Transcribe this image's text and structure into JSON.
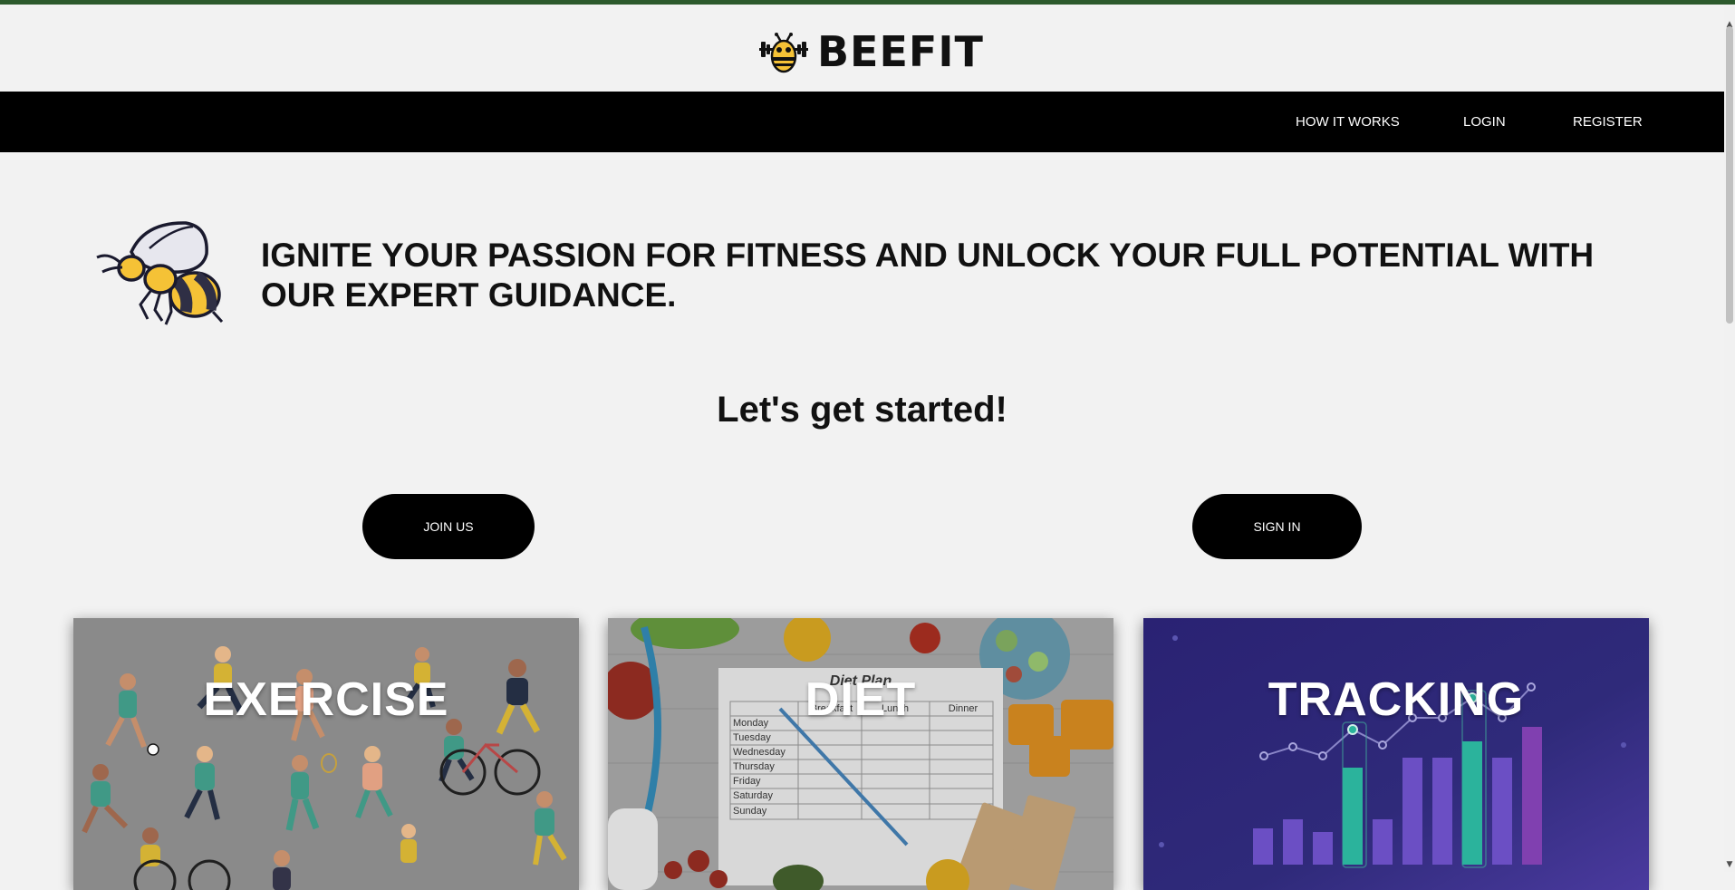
{
  "brand": {
    "name": "BEEFIT",
    "logo_icon": "bee-barbell-icon"
  },
  "nav": {
    "items": [
      {
        "label": "HOW IT WORKS"
      },
      {
        "label": "LOGIN"
      },
      {
        "label": "REGISTER"
      }
    ]
  },
  "hero": {
    "icon": "bee-icon",
    "text": "IGNITE YOUR PASSION FOR FITNESS AND UNLOCK YOUR FULL POTENTIAL WITH OUR EXPERT GUIDANCE."
  },
  "cta": {
    "heading": "Let's get started!",
    "join_label": "JOIN US",
    "signin_label": "SIGN IN"
  },
  "cards": [
    {
      "title": "EXERCISE"
    },
    {
      "title": "DIET",
      "diet_plan": {
        "title": "Diet Plan",
        "columns": [
          "Breakfast",
          "Lunch",
          "Dinner"
        ],
        "days": [
          "Monday",
          "Tuesday",
          "Wednesday",
          "Thursday",
          "Friday",
          "Saturday",
          "Sunday"
        ]
      }
    },
    {
      "title": "TRACKING"
    }
  ],
  "colors": {
    "top_accent": "#2d5a2d",
    "navbar": "#000000",
    "page_bg": "#f2f2f2",
    "bee_yellow": "#f5c236",
    "tracking_bg": "#2f2a7a",
    "tracking_bar": "#6b4fc4",
    "tracking_highlight": "#2bb39c"
  }
}
